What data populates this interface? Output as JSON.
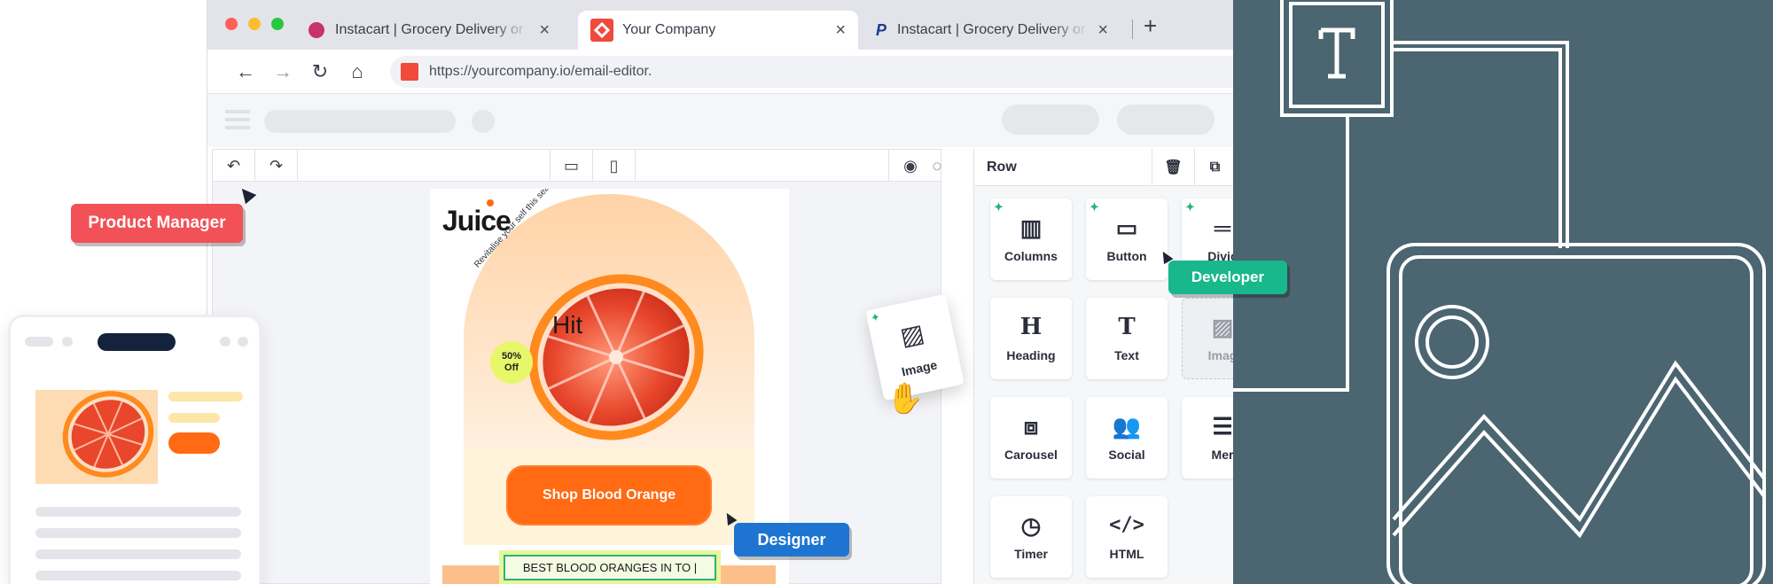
{
  "browser": {
    "tabs": [
      {
        "label": "Instacart | Grocery Delivery or",
        "close": "×"
      },
      {
        "label": "Your Company",
        "close": "×"
      },
      {
        "label": "Instacart | Grocery Delivery or",
        "close": "×"
      }
    ],
    "new_tab": "+",
    "url": "https://yourcompany.io/email-editor."
  },
  "panel": {
    "title": "Row",
    "blocks": [
      {
        "label": "Columns",
        "icon": "columns-icon"
      },
      {
        "label": "Button",
        "icon": "button-icon"
      },
      {
        "label": "Divic",
        "icon": "divider-icon"
      },
      {
        "label": "Heading",
        "icon": "heading-icon"
      },
      {
        "label": "Text",
        "icon": "text-icon"
      },
      {
        "label": "Imag",
        "icon": "image-icon"
      },
      {
        "label": "Carousel",
        "icon": "carousel-icon"
      },
      {
        "label": "Social",
        "icon": "social-icon"
      },
      {
        "label": "Mer",
        "icon": "menu-icon"
      },
      {
        "label": "Timer",
        "icon": "timer-icon"
      },
      {
        "label": "HTML",
        "icon": "code-icon"
      }
    ]
  },
  "email": {
    "logo": "Juice",
    "curved_text": "Revitalise your self this season",
    "headline": "Hit",
    "badge": "50% Off",
    "cta": "Shop Blood Orange",
    "text_block": "BEST BLOOD ORANGES IN TO |"
  },
  "drag_card": {
    "label": "Image"
  },
  "labels": {
    "product_manager": "Product Manager",
    "developer": "Developer",
    "designer": "Designer"
  },
  "colors": {
    "dark_bg": "#4b6571",
    "orange": "#ff6a13",
    "pm_red": "#f25157",
    "dev_green": "#18b78c",
    "designer_blue": "#1d74d1"
  }
}
